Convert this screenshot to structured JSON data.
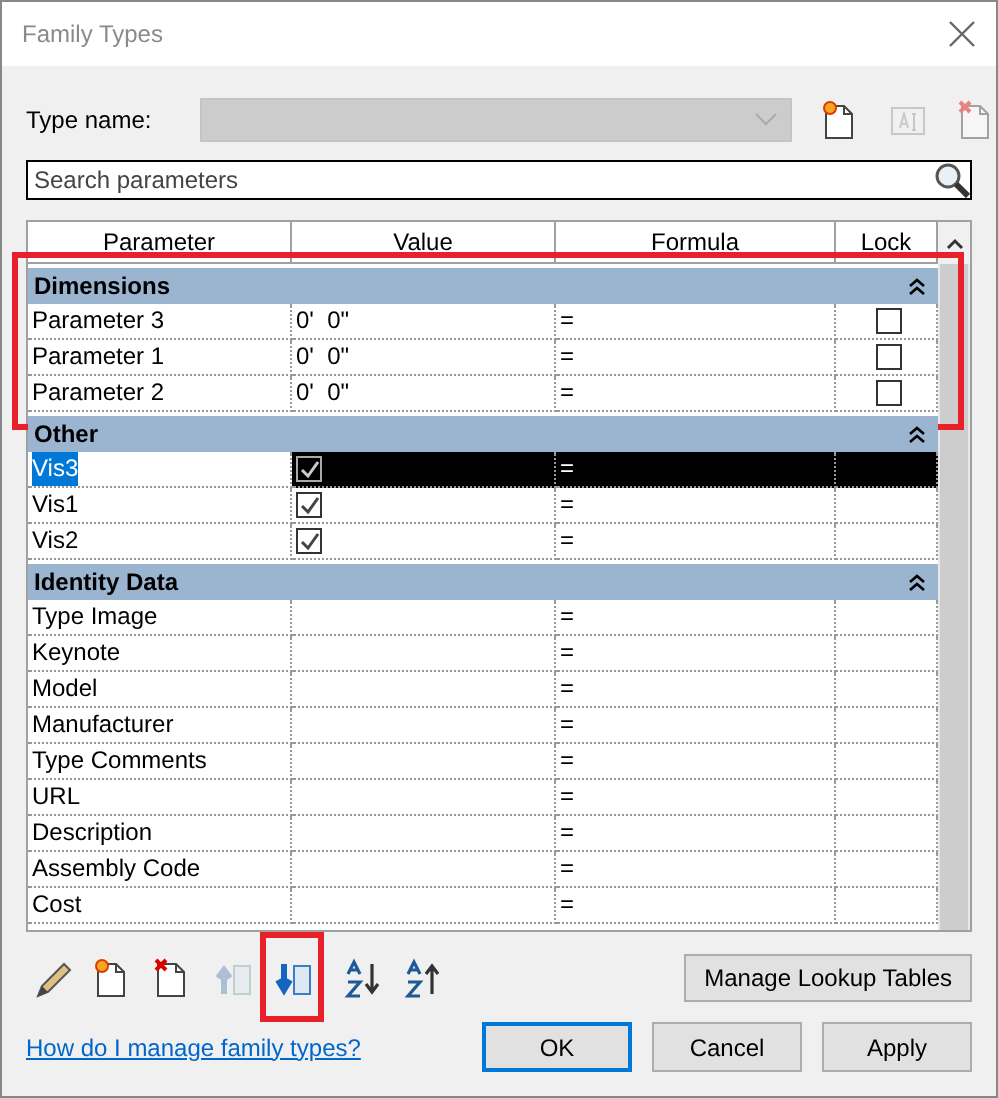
{
  "window": {
    "title": "Family Types"
  },
  "type_name": {
    "label": "Type name:",
    "disabled": true
  },
  "type_tools": [
    {
      "kind": "new",
      "disabled": false
    },
    {
      "kind": "rename",
      "disabled": true
    },
    {
      "kind": "delete",
      "disabled": true
    }
  ],
  "search": {
    "placeholder": "Search parameters"
  },
  "table": {
    "columns": [
      "Parameter",
      "Value",
      "Formula",
      "Lock"
    ],
    "groups": [
      {
        "name": "Dimensions",
        "expanded": true,
        "highlighted": true,
        "rows": [
          {
            "kind": "length",
            "parameter": "Parameter 3",
            "value": "0'  0\"",
            "formula": "=",
            "locked": false,
            "selected": false
          },
          {
            "kind": "length",
            "parameter": "Parameter 1",
            "value": "0'  0\"",
            "formula": "=",
            "locked": false,
            "selected": false
          },
          {
            "kind": "length",
            "parameter": "Parameter 2",
            "value": "0'  0\"",
            "formula": "=",
            "locked": false,
            "selected": false
          }
        ]
      },
      {
        "name": "Other",
        "expanded": true,
        "highlighted": false,
        "rows": [
          {
            "kind": "yesno",
            "parameter": "Vis3",
            "checked": true,
            "formula": "=",
            "selected": true
          },
          {
            "kind": "yesno",
            "parameter": "Vis1",
            "checked": true,
            "formula": "=",
            "selected": false
          },
          {
            "kind": "yesno",
            "parameter": "Vis2",
            "checked": true,
            "formula": "=",
            "selected": false
          }
        ]
      },
      {
        "name": "Identity Data",
        "expanded": true,
        "highlighted": false,
        "rows": [
          {
            "kind": "text",
            "parameter": "Type Image",
            "formula": "=",
            "selected": false
          },
          {
            "kind": "text",
            "parameter": "Keynote",
            "formula": "=",
            "selected": false
          },
          {
            "kind": "text",
            "parameter": "Model",
            "formula": "=",
            "selected": false
          },
          {
            "kind": "text",
            "parameter": "Manufacturer",
            "formula": "=",
            "selected": false
          },
          {
            "kind": "text",
            "parameter": "Type Comments",
            "formula": "=",
            "selected": false
          },
          {
            "kind": "text",
            "parameter": "URL",
            "formula": "=",
            "selected": false
          },
          {
            "kind": "text",
            "parameter": "Description",
            "formula": "=",
            "selected": false
          },
          {
            "kind": "text",
            "parameter": "Assembly Code",
            "formula": "=",
            "selected": false
          },
          {
            "kind": "text",
            "parameter": "Cost",
            "formula": "=",
            "selected": false
          }
        ]
      }
    ]
  },
  "toolbar": [
    {
      "kind": "edit",
      "disabled": false,
      "highlighted": false
    },
    {
      "kind": "new",
      "disabled": false,
      "highlighted": false
    },
    {
      "kind": "delete",
      "disabled": false,
      "highlighted": false
    },
    {
      "kind": "move-up",
      "disabled": true,
      "highlighted": false
    },
    {
      "kind": "move-down",
      "disabled": false,
      "highlighted": true
    },
    {
      "kind": "sort-asc",
      "disabled": false,
      "highlighted": false
    },
    {
      "kind": "sort-desc",
      "disabled": false,
      "highlighted": false
    }
  ],
  "lookup_button": "Manage Lookup Tables",
  "help_link": "How do I manage family types?",
  "buttons": [
    {
      "label": "OK",
      "default": true
    },
    {
      "label": "Cancel",
      "default": false
    },
    {
      "label": "Apply",
      "default": false
    }
  ]
}
